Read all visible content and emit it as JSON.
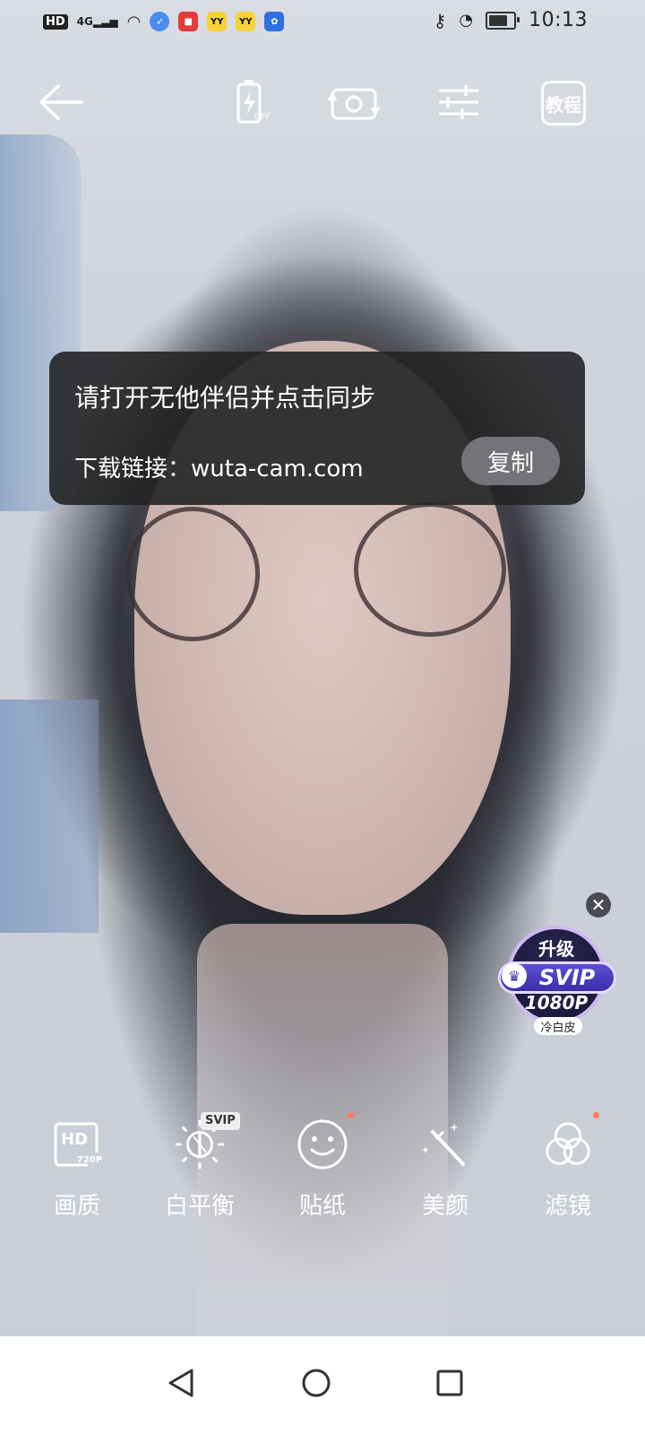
{
  "status_bar": {
    "hd": "HD",
    "network": "4G",
    "yy1": "YY",
    "yy2": "YY",
    "time": "10:13"
  },
  "top_bar": {
    "flash_state": "OFF",
    "tutorial": "教程"
  },
  "popup": {
    "title": "请打开无他伴侣并点击同步",
    "link_text": "下载链接：wuta-cam.com",
    "copy_button": "复制"
  },
  "upgrade_badge": {
    "upgrade": "升级",
    "svip": "SVIP",
    "resolution": "1080P",
    "effect": "冷白皮"
  },
  "tools": {
    "quality": {
      "icon_text": "HD",
      "sub": "720P",
      "label": "画质"
    },
    "white_balance": {
      "tag": "SVIP",
      "label": "白平衡"
    },
    "sticker": {
      "label": "贴纸"
    },
    "beauty": {
      "label": "美颜"
    },
    "filter": {
      "label": "滤镜"
    }
  },
  "colors": {
    "popup_bg": "#242426",
    "accent_dot": "#ff7a5a",
    "badge_purple": "#3a2fa8"
  }
}
